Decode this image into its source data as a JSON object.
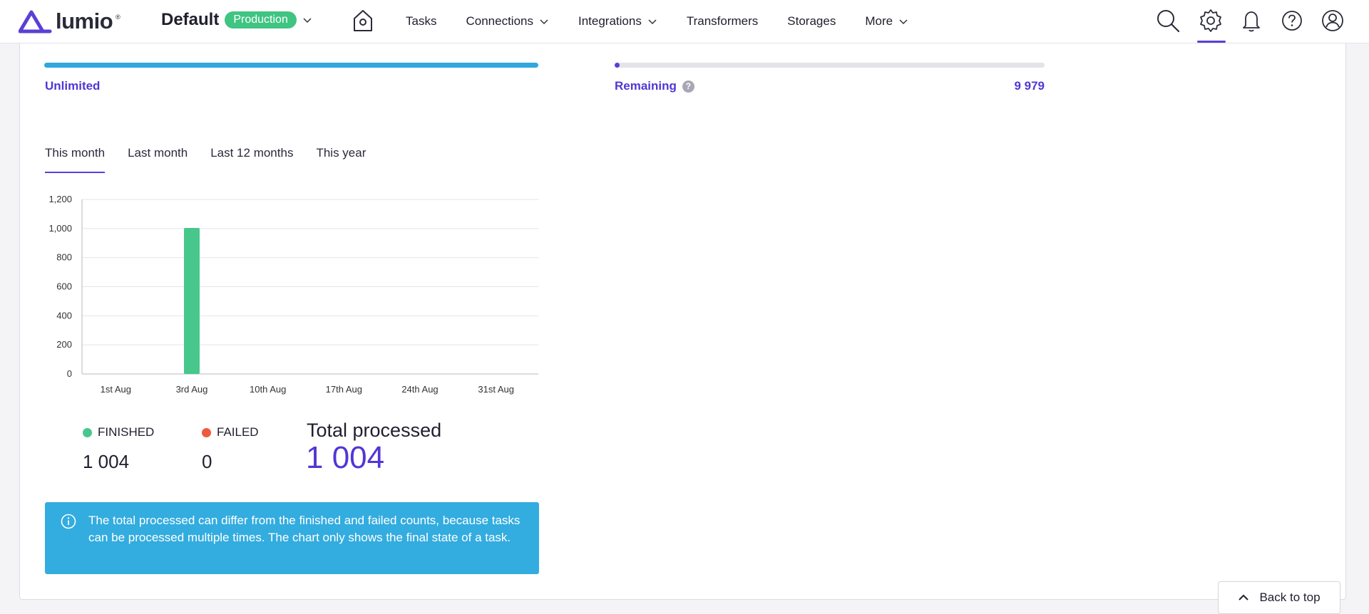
{
  "brand": {
    "name": "lumio",
    "registered": "®"
  },
  "environment": {
    "name": "Default",
    "badge": "Production"
  },
  "nav": {
    "tasks": "Tasks",
    "connections": "Connections",
    "integrations": "Integrations",
    "transformers": "Transformers",
    "storages": "Storages",
    "more": "More"
  },
  "icons": [
    "home-icon",
    "search-icon",
    "gear-icon",
    "bell-icon",
    "help-icon",
    "user-icon",
    "chevron-down-icon",
    "info-icon",
    "chevron-up-icon"
  ],
  "usage": {
    "left_label": "Unlimited",
    "left_fill": 1.0,
    "right_label": "Remaining",
    "right_help": "?",
    "right_value": "9 979"
  },
  "tabs": [
    {
      "label": "This month",
      "active": true
    },
    {
      "label": "Last month",
      "active": false
    },
    {
      "label": "Last 12 months",
      "active": false
    },
    {
      "label": "This year",
      "active": false
    }
  ],
  "chart_data": {
    "type": "bar",
    "categories": [
      "1st Aug",
      "3rd Aug",
      "10th Aug",
      "17th Aug",
      "24th Aug",
      "31st Aug"
    ],
    "values": [
      0,
      1004,
      0,
      0,
      0,
      0
    ],
    "y_ticks": [
      "0",
      "200",
      "400",
      "600",
      "800",
      "1,000",
      "1,200"
    ],
    "ylim": [
      0,
      1200
    ],
    "grid": true,
    "color": "#47c78c"
  },
  "stats": {
    "finished_label": "FINISHED",
    "finished_value": "1 004",
    "finished_color": "#47c78c",
    "failed_label": "FAILED",
    "failed_value": "0",
    "failed_color": "#ef5a3f",
    "total_label": "Total processed",
    "total_value": "1 004"
  },
  "info": {
    "text": "The total processed can differ from the finished and failed counts, because tasks can be processed multiple times. The chart only shows the final state of a task."
  },
  "back_to_top": "Back to top",
  "colors": {
    "accent": "#5236d4",
    "info_bg": "#33acdf",
    "progress": "#2fa8dd"
  }
}
